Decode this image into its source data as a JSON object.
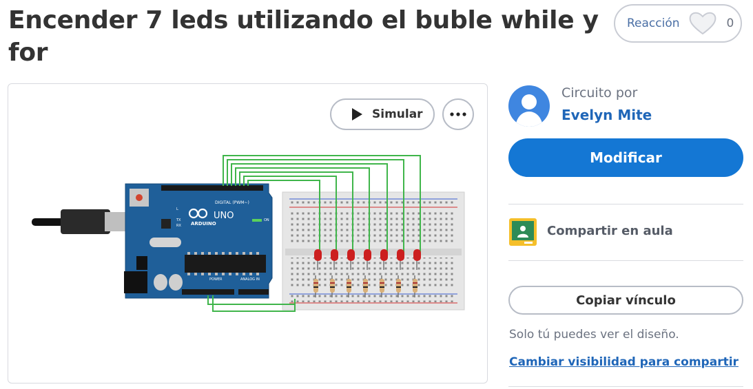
{
  "title": "Encender 7 leds utilizando el buble while y for",
  "reaction": {
    "label": "Reacción",
    "count": "0"
  },
  "preview": {
    "simulate_label": "Simular",
    "board": {
      "brand": "ARDUINO",
      "model": "UNO",
      "digital_label": "DIGITAL (PWM~)",
      "power_label": "POWER",
      "analog_label": "ANALOG IN",
      "on_label": "ON",
      "tx_label": "TX",
      "rx_label": "RX",
      "l_label": "L"
    },
    "led_color": "#cc1f1f",
    "wire_color": "#3fb54a"
  },
  "author": {
    "prefix": "Circuito por",
    "name": "Evelyn Mite"
  },
  "actions": {
    "modify_label": "Modificar",
    "classroom_label": "Compartir en aula",
    "copy_link_label": "Copiar vínculo",
    "visibility_note": "Solo tú puedes ver el diseño.",
    "visibility_link": "Cambiar visibilidad para compartir"
  },
  "colors": {
    "accent": "#1477d4",
    "link": "#1f66b8",
    "board_blue": "#1f5f99"
  }
}
